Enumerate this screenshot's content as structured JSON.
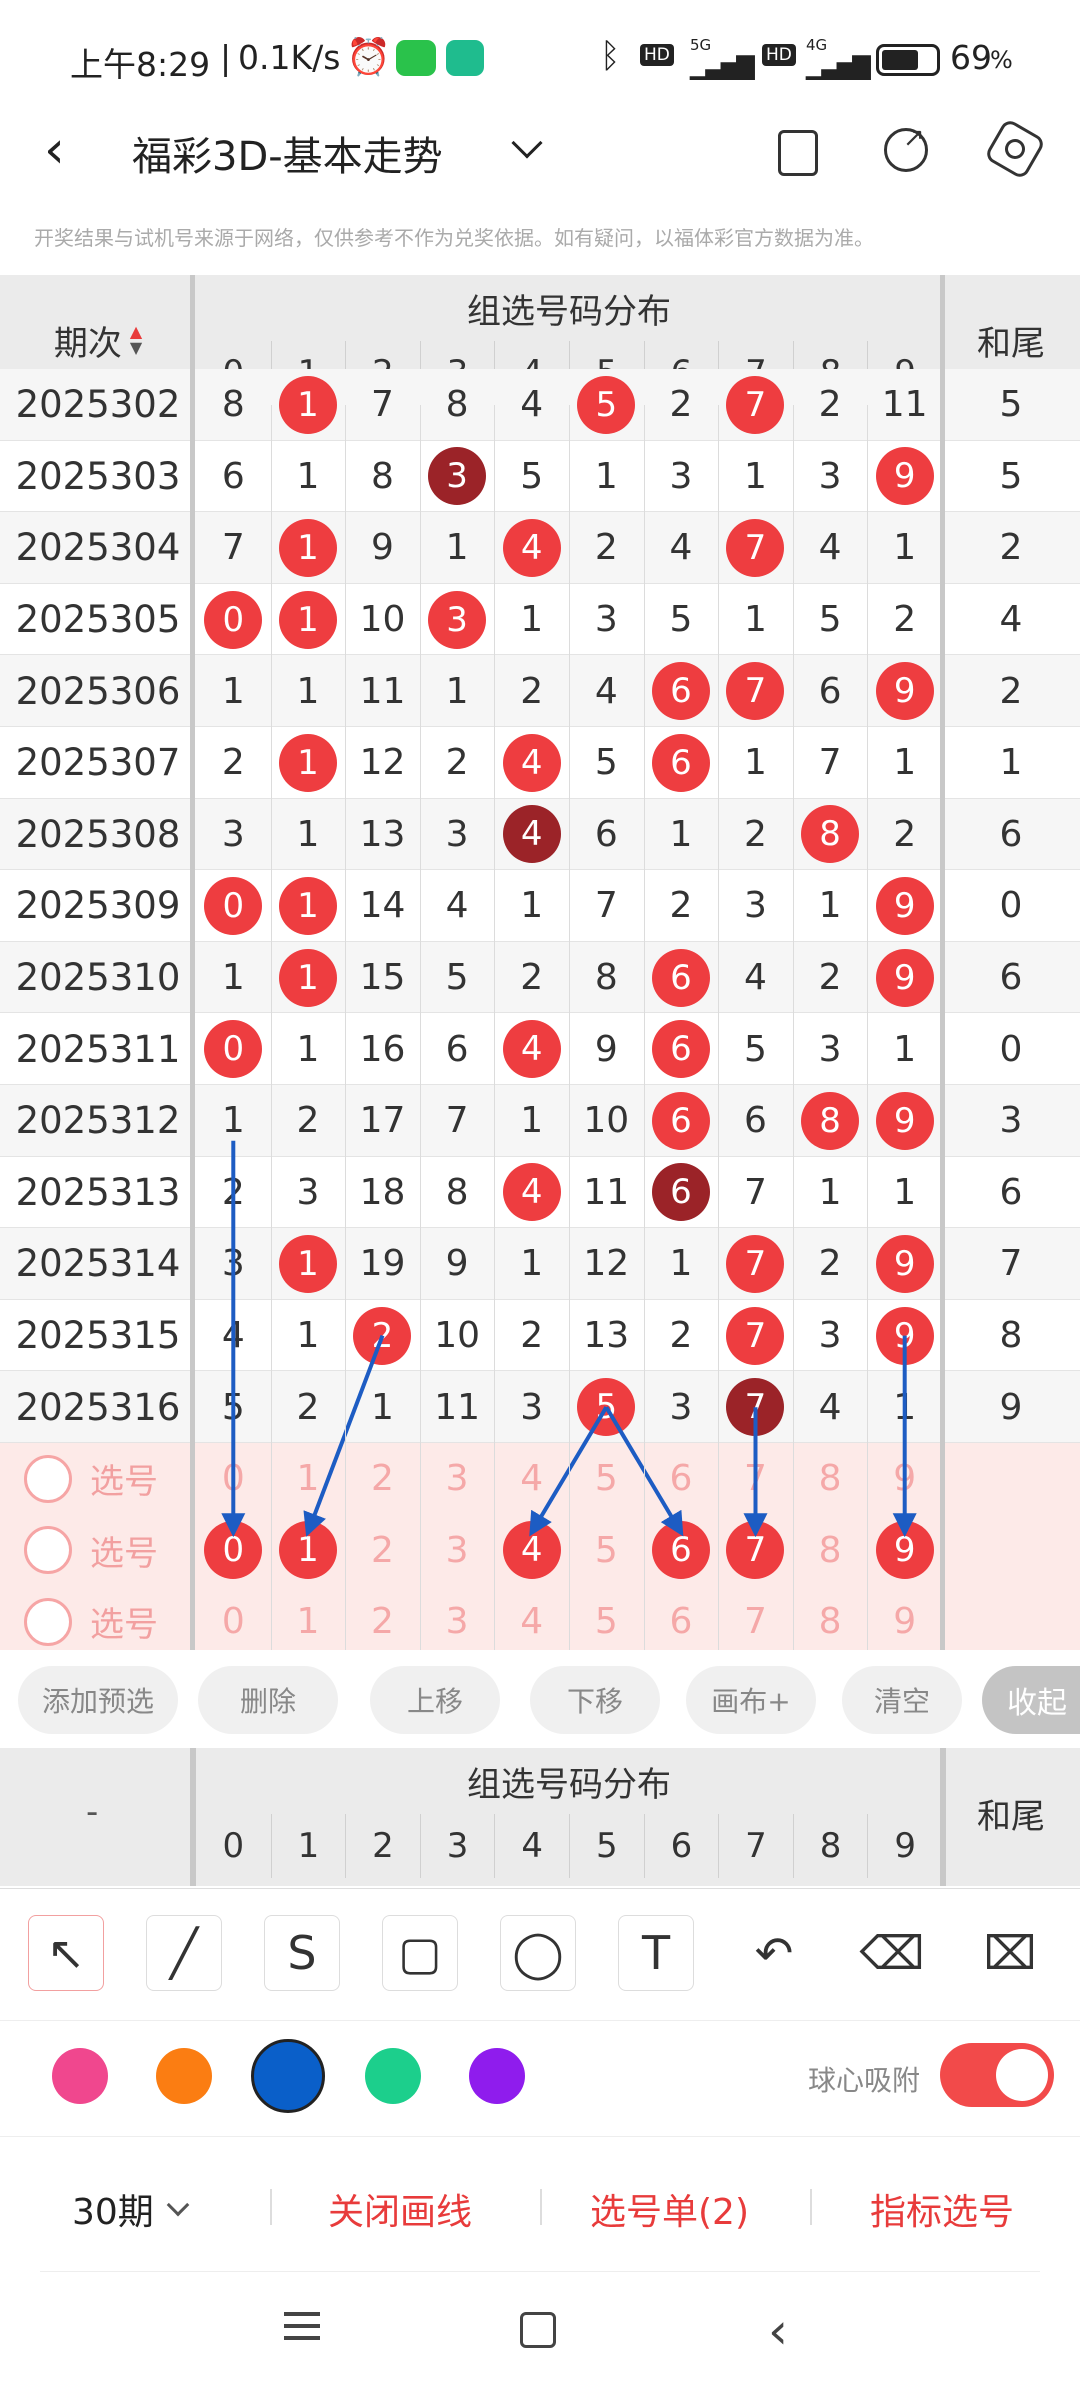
{
  "status": {
    "time": "上午8:29",
    "speed": "0.1K/s",
    "battery": "69",
    "battery_suffix": "%",
    "net1": "HD",
    "net2": "HD",
    "sig1": "5G",
    "sig2": "4G"
  },
  "header": {
    "title": "福彩3D-基本走势",
    "notice": "开奖结果与试机号来源于网络，仅供参考不作为兑奖依据。如有疑问，以福体彩官方数据为准。"
  },
  "table": {
    "col_issue": "期次",
    "col_group": "组选号码分布",
    "col_tail": "和尾",
    "digits": [
      "0",
      "1",
      "2",
      "3",
      "4",
      "5",
      "6",
      "7",
      "8",
      "9"
    ],
    "rows": [
      {
        "issue": "2025302",
        "cells": [
          "8",
          "1",
          "7",
          "8",
          "4",
          "5",
          "2",
          "7",
          "2",
          "11"
        ],
        "tail": "5",
        "hits": [
          1,
          5,
          7
        ],
        "dark": []
      },
      {
        "issue": "2025303",
        "cells": [
          "6",
          "1",
          "8",
          "3",
          "5",
          "1",
          "3",
          "1",
          "3",
          "9"
        ],
        "tail": "5",
        "hits": [
          3,
          9
        ],
        "dark": [
          3
        ]
      },
      {
        "issue": "2025304",
        "cells": [
          "7",
          "1",
          "9",
          "1",
          "4",
          "2",
          "4",
          "7",
          "4",
          "1"
        ],
        "tail": "2",
        "hits": [
          1,
          4,
          7
        ],
        "dark": []
      },
      {
        "issue": "2025305",
        "cells": [
          "0",
          "1",
          "10",
          "3",
          "1",
          "3",
          "5",
          "1",
          "5",
          "2"
        ],
        "tail": "4",
        "hits": [
          0,
          1,
          3
        ],
        "dark": []
      },
      {
        "issue": "2025306",
        "cells": [
          "1",
          "1",
          "11",
          "1",
          "2",
          "4",
          "6",
          "7",
          "6",
          "9"
        ],
        "tail": "2",
        "hits": [
          6,
          7,
          9
        ],
        "dark": []
      },
      {
        "issue": "2025307",
        "cells": [
          "2",
          "1",
          "12",
          "2",
          "4",
          "5",
          "6",
          "1",
          "7",
          "1"
        ],
        "tail": "1",
        "hits": [
          1,
          4,
          6
        ],
        "dark": []
      },
      {
        "issue": "2025308",
        "cells": [
          "3",
          "1",
          "13",
          "3",
          "4",
          "6",
          "1",
          "2",
          "8",
          "2"
        ],
        "tail": "6",
        "hits": [
          4,
          8
        ],
        "dark": [
          4
        ]
      },
      {
        "issue": "2025309",
        "cells": [
          "0",
          "1",
          "14",
          "4",
          "1",
          "7",
          "2",
          "3",
          "1",
          "9"
        ],
        "tail": "0",
        "hits": [
          0,
          1,
          9
        ],
        "dark": []
      },
      {
        "issue": "2025310",
        "cells": [
          "1",
          "1",
          "15",
          "5",
          "2",
          "8",
          "6",
          "4",
          "2",
          "9"
        ],
        "tail": "6",
        "hits": [
          1,
          6,
          9
        ],
        "dark": []
      },
      {
        "issue": "2025311",
        "cells": [
          "0",
          "1",
          "16",
          "6",
          "4",
          "9",
          "6",
          "5",
          "3",
          "1"
        ],
        "tail": "0",
        "hits": [
          0,
          4,
          6
        ],
        "dark": []
      },
      {
        "issue": "2025312",
        "cells": [
          "1",
          "2",
          "17",
          "7",
          "1",
          "10",
          "6",
          "6",
          "8",
          "9"
        ],
        "tail": "3",
        "hits": [
          6,
          8,
          9
        ],
        "dark": []
      },
      {
        "issue": "2025313",
        "cells": [
          "2",
          "3",
          "18",
          "8",
          "4",
          "11",
          "6",
          "7",
          "1",
          "1"
        ],
        "tail": "6",
        "hits": [
          4,
          6
        ],
        "dark": [
          6
        ]
      },
      {
        "issue": "2025314",
        "cells": [
          "3",
          "1",
          "19",
          "9",
          "1",
          "12",
          "1",
          "7",
          "2",
          "9"
        ],
        "tail": "7",
        "hits": [
          1,
          7,
          9
        ],
        "dark": []
      },
      {
        "issue": "2025315",
        "cells": [
          "4",
          "1",
          "2",
          "10",
          "2",
          "13",
          "2",
          "7",
          "3",
          "9"
        ],
        "tail": "8",
        "hits": [
          2,
          7,
          9
        ],
        "dark": []
      },
      {
        "issue": "2025316",
        "cells": [
          "5",
          "2",
          "1",
          "11",
          "3",
          "5",
          "3",
          "7",
          "4",
          "1"
        ],
        "tail": "9",
        "hits": [
          5,
          7
        ],
        "dark": [
          7
        ]
      }
    ],
    "pick_label": "选号",
    "picks": [
      {
        "selected": []
      },
      {
        "selected": [
          0,
          1,
          4,
          6,
          7,
          9
        ]
      },
      {
        "selected": []
      }
    ]
  },
  "actions": [
    "添加预选",
    "删除",
    "上移",
    "下移",
    "画布+",
    "清空",
    "收起"
  ],
  "tools": [
    "cursor-tool",
    "line-tool",
    "curve-tool",
    "rect-tool",
    "circle-tool",
    "text-tool",
    "undo-tool",
    "eraser-tool",
    "clear-tool"
  ],
  "colors": [
    "#f0478e",
    "#fb7d12",
    "#0a5fc9",
    "#1ccf8c",
    "#8f1ced"
  ],
  "snap_label": "球心吸附",
  "snap_on": true,
  "bottom": {
    "period": "30期",
    "close_draw": "关闭画线",
    "pick_list": "选号单(2)",
    "indicator_pick": "指标选号"
  },
  "palette": {
    "ball": "#ee3d40",
    "ball_dark": "#9b2328",
    "line": "#1d5cc3",
    "accent": "#e83b3b",
    "pick_bg": "#fdeae8"
  }
}
